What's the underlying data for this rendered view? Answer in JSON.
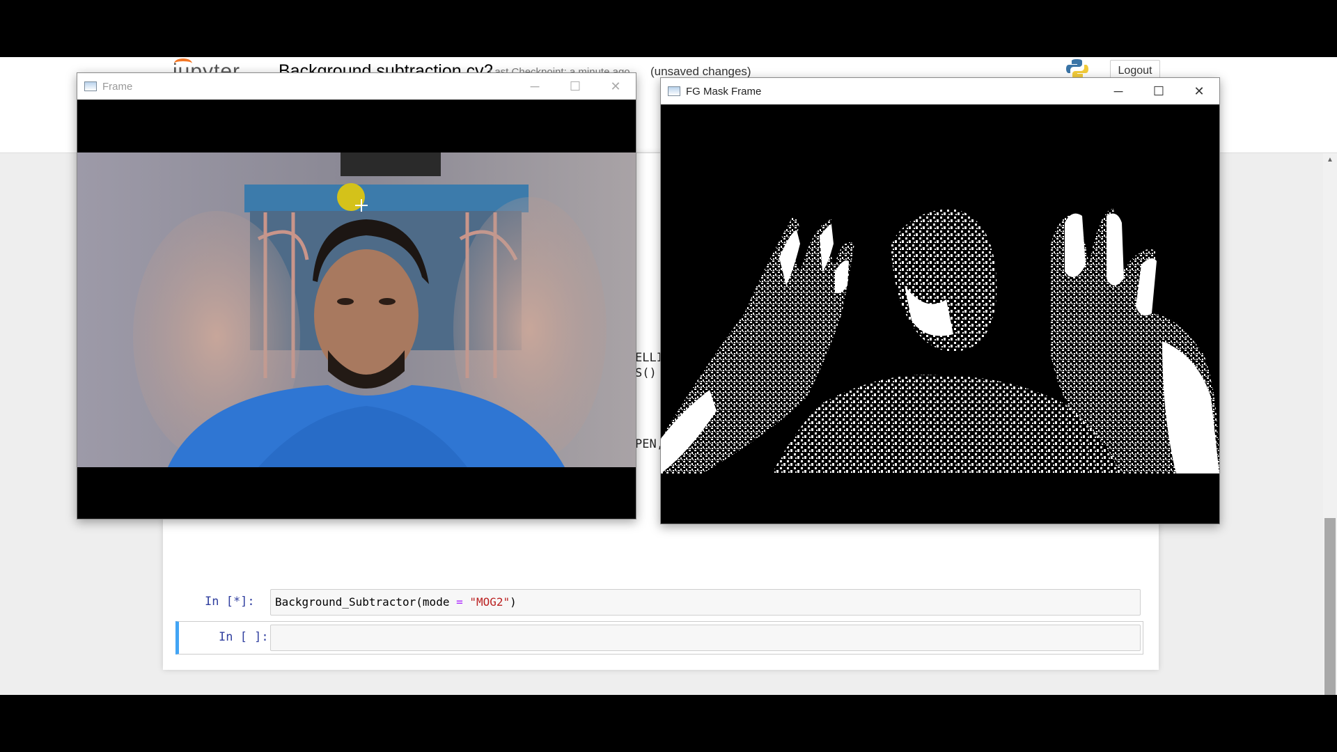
{
  "jupyter": {
    "logo_text": "jupyter",
    "notebook_title": "Background subtraction cv2",
    "checkpoint": "Last Checkpoint: a minute ago",
    "unsaved": "(unsaved changes)",
    "logout_label": "Logout",
    "code_fragments": [
      "ELLI",
      "S()",
      "PEN,"
    ],
    "cells": [
      {
        "prompt": "In [*]:",
        "code_func": "Background_Subtractor(mode ",
        "code_op": "=",
        "code_sp": " ",
        "code_str": "\"MOG2\"",
        "code_end": ")"
      },
      {
        "prompt": "In [ ]:",
        "code": ""
      }
    ]
  },
  "windows": {
    "frame": {
      "title": "Frame",
      "controls": [
        "─",
        "☐",
        "✕"
      ]
    },
    "fg_mask": {
      "title": "FG Mask Frame",
      "controls": [
        "─",
        "☐",
        "✕"
      ]
    }
  },
  "colors": {
    "cell_selected": "#42a5f5",
    "prompt": "#303f9f",
    "string": "#ba2121",
    "tracking_dot": "#d4c21a"
  },
  "icons": [
    "window-icon",
    "minimize-icon",
    "maximize-icon",
    "close-icon",
    "python-icon",
    "jupyter-logo-icon",
    "crosshair-cursor-icon"
  ]
}
